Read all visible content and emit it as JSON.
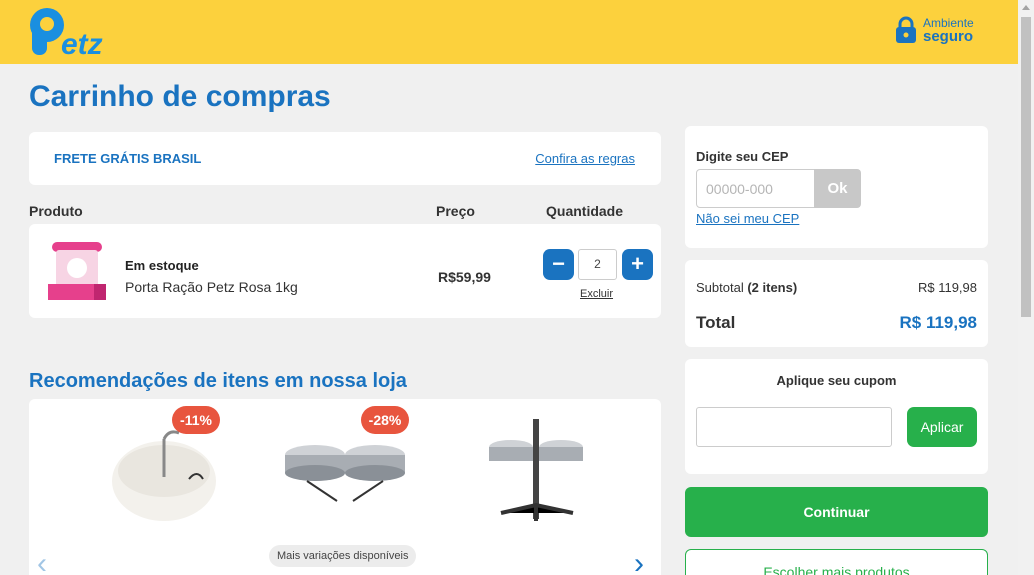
{
  "header": {
    "logo_text": "Petz",
    "secure_line1": "Ambiente",
    "secure_line2": "seguro"
  },
  "page_title": "Carrinho de compras",
  "shipping": {
    "label": "FRETE GRÁTIS BRASIL",
    "rules_link": "Confira as regras"
  },
  "columns": {
    "product": "Produto",
    "price": "Preço",
    "quantity": "Quantidade"
  },
  "cart_item": {
    "stock_status": "Em estoque",
    "name": "Porta Ração Petz Rosa 1kg",
    "price": "R$59,99",
    "quantity": "2",
    "remove_label": "Excluir",
    "minus": "−",
    "plus": "+"
  },
  "recommendations": {
    "title": "Recomendações de itens em nossa loja",
    "items": [
      {
        "discount": "-11%"
      },
      {
        "discount": "-28%",
        "variations": "Mais variações disponíveis"
      },
      {}
    ]
  },
  "cep": {
    "label": "Digite seu CEP",
    "placeholder": "00000-000",
    "ok_label": "Ok",
    "unknown_link": "Não sei meu CEP"
  },
  "totals": {
    "subtotal_label": "Subtotal",
    "subtotal_items": "(2 itens)",
    "subtotal_value": "R$ 119,98",
    "total_label": "Total",
    "total_value": "R$ 119,98"
  },
  "coupon": {
    "label": "Aplique seu cupom",
    "value": "",
    "apply_label": "Aplicar"
  },
  "actions": {
    "continue_label": "Continuar",
    "choose_more_label": "Escolher mais produtos"
  },
  "colors": {
    "brand_yellow": "#fcd13d",
    "brand_blue": "#1a73c0",
    "action_green": "#27b04b",
    "discount_red": "#e8553e"
  }
}
